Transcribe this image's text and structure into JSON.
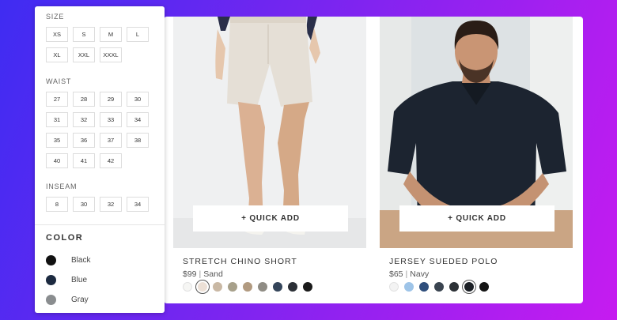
{
  "filters": {
    "size": {
      "heading": "SIZE",
      "options": [
        "XS",
        "S",
        "M",
        "L",
        "XL",
        "XXL",
        "XXXL"
      ]
    },
    "waist": {
      "heading": "WAIST",
      "options": [
        "27",
        "28",
        "29",
        "30",
        "31",
        "32",
        "33",
        "34",
        "35",
        "36",
        "37",
        "38",
        "40",
        "41",
        "42"
      ]
    },
    "inseam": {
      "heading": "INSEAM",
      "options": [
        "8",
        "30",
        "32",
        "34"
      ]
    },
    "color": {
      "heading": "COLOR",
      "options": [
        {
          "label": "Black",
          "swatch": "#111111"
        },
        {
          "label": "Blue",
          "swatch": "#1c2a40"
        },
        {
          "label": "Gray",
          "swatch": "#8a8d8f"
        }
      ]
    }
  },
  "products": [
    {
      "quick_add": "+ QUICK ADD",
      "name": "STRETCH CHINO SHORT",
      "price": "$99",
      "color": "Sand",
      "selected_swatch": 1,
      "swatches": [
        "#f6f6f4",
        "#ece0d6",
        "#c9b8a4",
        "#a7a08a",
        "#b19a80",
        "#8f8c84",
        "#34455a",
        "#2b2f36",
        "#1a1a1a"
      ]
    },
    {
      "quick_add": "+ QUICK ADD",
      "name": "JERSEY SUEDED POLO",
      "price": "$65",
      "color": "Navy",
      "selected_swatch": 5,
      "swatches": [
        "#f3f3f3",
        "#9ec4e8",
        "#2f4e7c",
        "#3a4450",
        "#2c3136",
        "#1c2026",
        "#151515"
      ]
    }
  ]
}
